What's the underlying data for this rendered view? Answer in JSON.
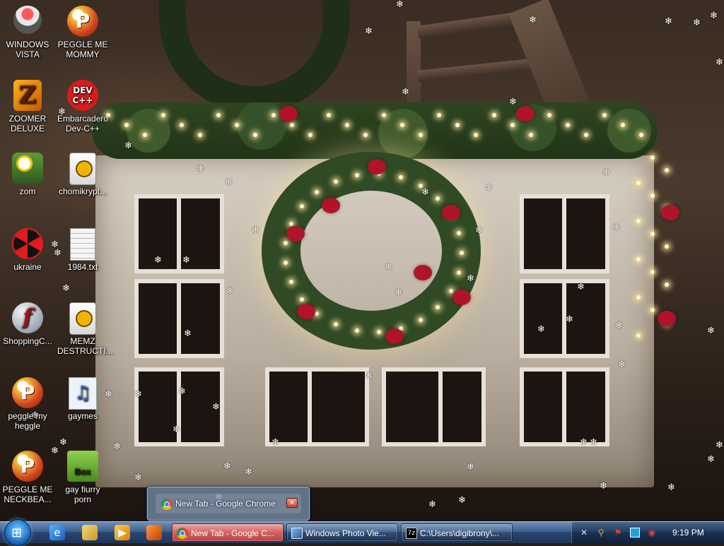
{
  "desktop": {
    "icons": [
      {
        "label": "WINDOWS VISTA"
      },
      {
        "label": "PEGGLE ME MOMMY"
      },
      {
        "label": "ZOOMER DELUXE"
      },
      {
        "label": "Embarcadero Dev-C++"
      },
      {
        "label": "zom"
      },
      {
        "label": "chomikrypt..."
      },
      {
        "label": "ukraine"
      },
      {
        "label": "1984.txt"
      },
      {
        "label": "ShoppingC..."
      },
      {
        "label": "MEMZ DESTRUCTI..."
      },
      {
        "label": "peggle my heggle"
      },
      {
        "label": "gaymes"
      },
      {
        "label": "PEGGLE ME NECKBEA..."
      },
      {
        "label": "gay fiurry porn"
      }
    ],
    "icon_glyphs": {
      "peggle": "P",
      "devcpp": "DEV C++",
      "zoomer": "Z",
      "flash": "f",
      "music": "♫",
      "box": "Box"
    }
  },
  "taskbar": {
    "buttons": [
      {
        "label": "New Tab - Google C..."
      },
      {
        "label": "Windows Photo Vie..."
      },
      {
        "label": "C:\\Users\\digibrony\\..."
      }
    ],
    "cmd_icon_text": "7z",
    "clock": "9:19 PM",
    "start_glyph": "⊞"
  },
  "preview": {
    "title": "New Tab - Google Chrome",
    "close_glyph": "✕"
  },
  "colors": {
    "taskbar": "#2a4670",
    "active_task": "#d26060",
    "accent": "#1a6fc4"
  }
}
